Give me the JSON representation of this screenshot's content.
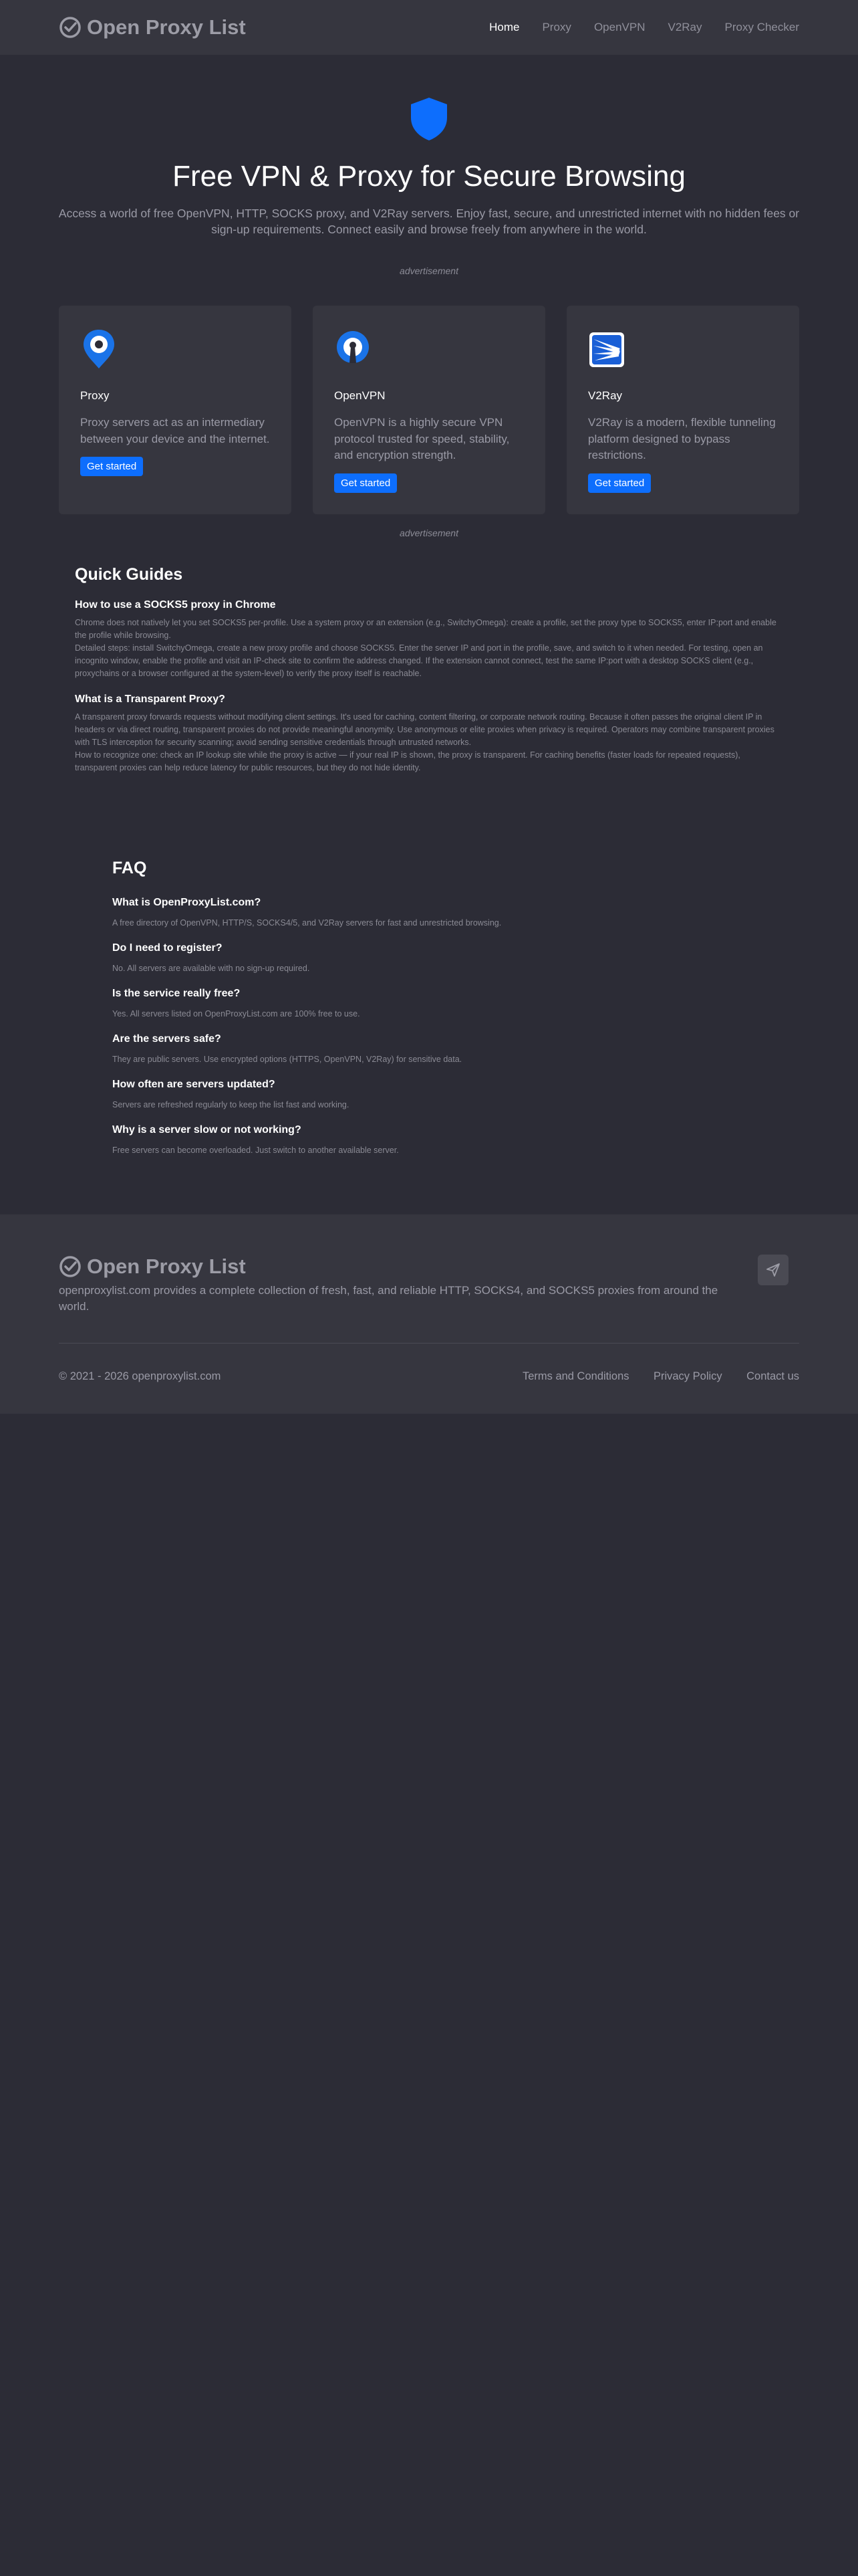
{
  "brand": {
    "name": "Open Proxy List"
  },
  "nav": {
    "items": [
      {
        "label": "Home",
        "active": true
      },
      {
        "label": "Proxy"
      },
      {
        "label": "OpenVPN"
      },
      {
        "label": "V2Ray"
      },
      {
        "label": "Proxy Checker"
      }
    ]
  },
  "hero": {
    "icon": "shield-icon",
    "title": "Free VPN & Proxy for Secure Browsing",
    "subtitle": "Access a world of free OpenVPN, HTTP, SOCKS proxy, and V2Ray servers. Enjoy fast, secure, and unrestricted internet with no hidden fees or sign-up requirements. Connect easily and browse freely from anywhere in the world."
  },
  "ads": {
    "label": "advertisement"
  },
  "cards": [
    {
      "icon": "location-pin-icon",
      "title": "Proxy",
      "text": "Proxy servers act as an intermediary between your device and the internet.",
      "button": "Get started"
    },
    {
      "icon": "keyhole-icon",
      "title": "OpenVPN",
      "text": "OpenVPN is a highly secure VPN protocol trusted for speed, stability, and encryption strength.",
      "button": "Get started"
    },
    {
      "icon": "v2ray-logo-icon",
      "title": "V2Ray",
      "text": "V2Ray is a modern, flexible tunneling platform designed to bypass restrictions.",
      "button": "Get started"
    }
  ],
  "guides": {
    "title": "Quick Guides",
    "items": [
      {
        "title": "How to use a SOCKS5 proxy in Chrome",
        "p1": "Chrome does not natively let you set SOCKS5 per-profile. Use a system proxy or an extension (e.g., SwitchyOmega): create a profile, set the proxy type to SOCKS5, enter IP:port and enable the profile while browsing.",
        "p2": "Detailed steps: install SwitchyOmega, create a new proxy profile and choose SOCKS5. Enter the server IP and port in the profile, save, and switch to it when needed. For testing, open an incognito window, enable the profile and visit an IP-check site to confirm the address changed. If the extension cannot connect, test the same IP:port with a desktop SOCKS client (e.g., proxychains or a browser configured at the system-level) to verify the proxy itself is reachable."
      },
      {
        "title": "What is a Transparent Proxy?",
        "p1": "A transparent proxy forwards requests without modifying client settings. It's used for caching, content filtering, or corporate network routing. Because it often passes the original client IP in headers or via direct routing, transparent proxies do not provide meaningful anonymity. Use anonymous or elite proxies when privacy is required. Operators may combine transparent proxies with TLS interception for security scanning; avoid sending sensitive credentials through untrusted networks.",
        "p2": "How to recognize one: check an IP lookup site while the proxy is active — if your real IP is shown, the proxy is transparent. For caching benefits (faster loads for repeated requests), transparent proxies can help reduce latency for public resources, but they do not hide identity."
      }
    ]
  },
  "faq": {
    "title": "FAQ",
    "items": [
      {
        "q": "What is OpenProxyList.com?",
        "a": "A free directory of OpenVPN, HTTP/S, SOCKS4/5, and V2Ray servers for fast and unrestricted browsing."
      },
      {
        "q": "Do I need to register?",
        "a": "No. All servers are available with no sign-up required."
      },
      {
        "q": "Is the service really free?",
        "a": "Yes. All servers listed on OpenProxyList.com are 100% free to use."
      },
      {
        "q": "Are the servers safe?",
        "a": "They are public servers. Use encrypted options (HTTPS, OpenVPN, V2Ray) for sensitive data."
      },
      {
        "q": "How often are servers updated?",
        "a": "Servers are refreshed regularly to keep the list fast and working."
      },
      {
        "q": "Why is a server slow or not working?",
        "a": "Free servers can become overloaded. Just switch to another available server."
      }
    ]
  },
  "footer": {
    "brand": "Open Proxy List",
    "description": "openproxylist.com provides a complete collection of fresh, fast, and reliable HTTP, SOCKS4, and SOCKS5 proxies from around the world.",
    "send_icon": "paper-plane-icon",
    "copyright": "© 2021 - 2026 openproxylist.com",
    "links": [
      "Terms and Conditions",
      "Privacy Policy",
      "Contact us"
    ]
  },
  "colors": {
    "accent": "#0d6efd",
    "background": "#2c2c36",
    "surface": "#36363f"
  }
}
